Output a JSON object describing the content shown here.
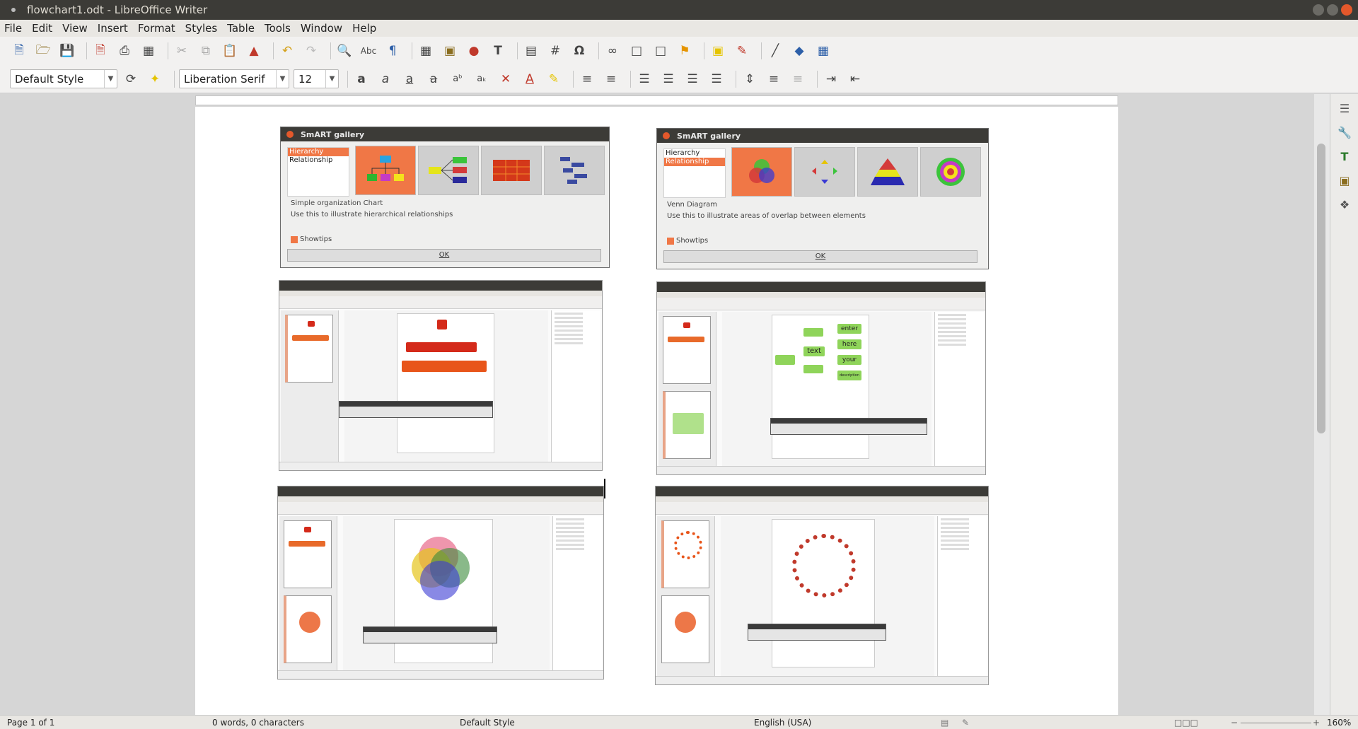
{
  "window": {
    "title": "flowchart1.odt - LibreOffice Writer"
  },
  "menu": [
    "File",
    "Edit",
    "View",
    "Insert",
    "Format",
    "Styles",
    "Table",
    "Tools",
    "Window",
    "Help"
  ],
  "formatting": {
    "paragraph_style": "Default Style",
    "font_name": "Liberation Serif",
    "font_size": "12"
  },
  "icons": {
    "standard": [
      "new-document-icon",
      "open-icon",
      "save-icon",
      "export-pdf-icon",
      "print-icon",
      "print-preview-icon",
      "cut-icon",
      "copy-icon",
      "paste-icon",
      "clone-formatting-icon",
      "undo-icon",
      "redo-icon",
      "find-replace-icon",
      "spelling-icon",
      "formatting-marks-icon",
      "insert-table-icon",
      "insert-image-icon",
      "insert-chart-icon",
      "insert-textbox-icon",
      "page-break-icon",
      "insert-field-icon",
      "special-character-icon",
      "hyperlink-icon",
      "footnote-icon",
      "endnote-icon",
      "bookmark-icon",
      "comment-icon",
      "track-changes-icon",
      "line-icon",
      "basic-shapes-icon",
      "draw-functions-icon"
    ],
    "formatting": [
      "update-style-icon",
      "new-style-icon",
      "bold-icon",
      "italic-icon",
      "underline-icon",
      "strikethrough-icon",
      "superscript-icon",
      "subscript-icon",
      "clear-formatting-icon",
      "font-color-icon",
      "highlighting-icon",
      "bullets-icon",
      "numbering-icon",
      "align-left-icon",
      "align-center-icon",
      "align-right-icon",
      "justify-icon",
      "line-spacing-icon",
      "increase-paragraph-spacing-icon",
      "decrease-paragraph-spacing-icon",
      "increase-indent-icon",
      "decrease-indent-icon"
    ],
    "sidebar": [
      "sidebar-menu-icon",
      "properties-icon",
      "styles-icon",
      "gallery-icon",
      "navigator-icon"
    ]
  },
  "document": {
    "dialogs": [
      {
        "title": "SmART gallery",
        "categories": [
          "Hierarchy",
          "Relationship"
        ],
        "selected_category": 0,
        "caption": "Simple organization Chart",
        "description": "Use this to illustrate hierarchical relationships",
        "showtips_label": "Showtips",
        "ok_label": "OK"
      },
      {
        "title": "SmART gallery",
        "categories": [
          "Hierarchy",
          "Relationship"
        ],
        "selected_category": 1,
        "caption": "Venn Diagram",
        "description": "Use this to illustrate areas of overlap between elements",
        "showtips_label": "Showtips",
        "ok_label": "OK"
      }
    ],
    "mindmap_labels": [
      "enter",
      "here",
      "your",
      "description",
      "text"
    ]
  },
  "status": {
    "page": "Page 1 of 1",
    "word_count": "0 words, 0 characters",
    "page_style": "Default Style",
    "language": "English (USA)",
    "zoom": "160%"
  },
  "colors": {
    "accent": "#f07746",
    "titlebar": "#3c3b37",
    "close_button": "#e4582b"
  }
}
